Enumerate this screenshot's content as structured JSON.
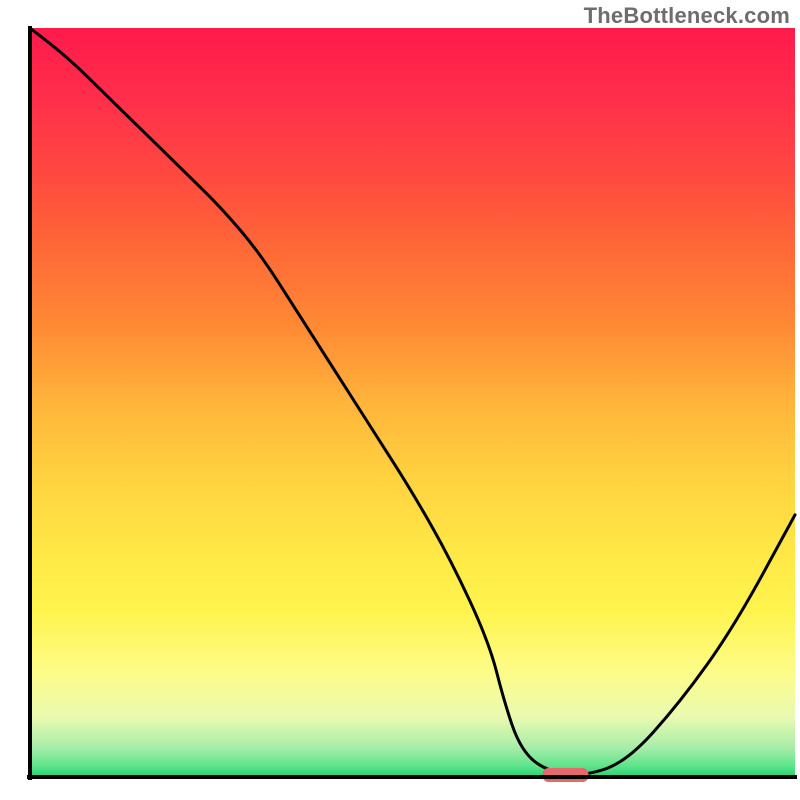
{
  "watermark": "TheBottleneck.com",
  "chart_data": {
    "type": "line",
    "title": "",
    "xlabel": "",
    "ylabel": "",
    "xlim": [
      0,
      100
    ],
    "ylim": [
      0,
      100
    ],
    "x": [
      0,
      5,
      10,
      15,
      20,
      25,
      30,
      35,
      40,
      45,
      50,
      55,
      60,
      62,
      64,
      67,
      72,
      78,
      85,
      92,
      100
    ],
    "y": [
      100,
      96,
      91,
      86,
      81,
      76,
      70,
      62,
      54,
      46,
      38,
      29,
      18,
      10,
      4,
      1,
      0,
      2,
      10,
      20,
      35
    ],
    "marker": {
      "x": 70,
      "y": 0,
      "width": 6,
      "height": 2
    },
    "gradient_stops": [
      {
        "offset": 0.0,
        "color": "#ff1a4b"
      },
      {
        "offset": 0.1,
        "color": "#ff304b"
      },
      {
        "offset": 0.2,
        "color": "#ff4a3f"
      },
      {
        "offset": 0.3,
        "color": "#ff6a37"
      },
      {
        "offset": 0.4,
        "color": "#ff8a35"
      },
      {
        "offset": 0.5,
        "color": "#ffb43b"
      },
      {
        "offset": 0.6,
        "color": "#ffd23f"
      },
      {
        "offset": 0.7,
        "color": "#ffe846"
      },
      {
        "offset": 0.78,
        "color": "#fff44f"
      },
      {
        "offset": 0.86,
        "color": "#fdfc88"
      },
      {
        "offset": 0.92,
        "color": "#e9fab0"
      },
      {
        "offset": 0.96,
        "color": "#a9eda9"
      },
      {
        "offset": 0.985,
        "color": "#5fe48c"
      },
      {
        "offset": 1.0,
        "color": "#24d471"
      }
    ],
    "line_color": "#000000",
    "axis_color": "#000000",
    "marker_color": "#e46a6a"
  }
}
